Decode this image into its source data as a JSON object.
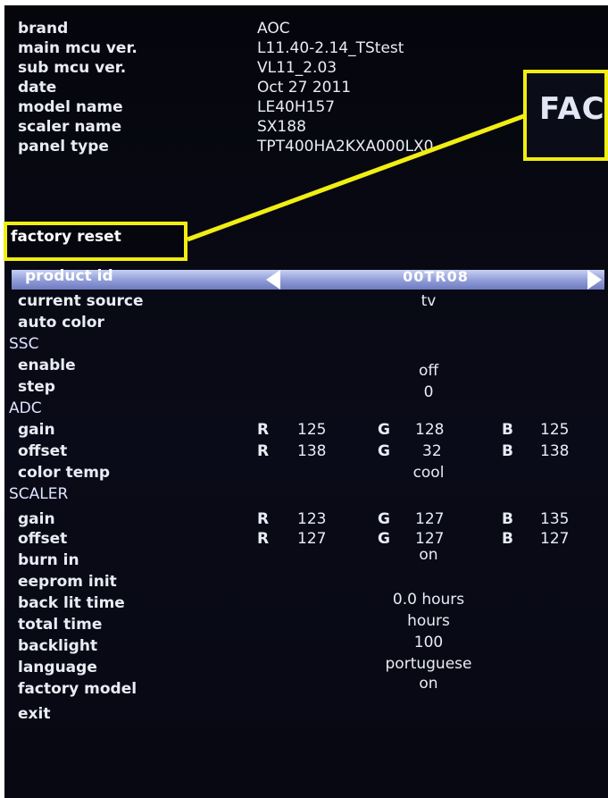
{
  "info": [
    {
      "label": "brand",
      "value": "AOC"
    },
    {
      "label": "main mcu ver.",
      "value": "L11.40-2.14_TStest"
    },
    {
      "label": "sub mcu ver.",
      "value": "VL11_2.03"
    },
    {
      "label": "date",
      "value": "Oct 27 2011"
    },
    {
      "label": "model name",
      "value": "LE40H157"
    },
    {
      "label": "scaler name",
      "value": "SX188"
    },
    {
      "label": "panel type",
      "value": "TPT400HA2KXA000LX0"
    }
  ],
  "callout": {
    "label": "factory reset",
    "zoom_text": "FAC"
  },
  "selected": {
    "label": "product id",
    "value": "00TR08"
  },
  "menu": {
    "current_source": {
      "label": "current source",
      "value": "tv"
    },
    "auto_color": {
      "label": "auto color"
    },
    "ssc": {
      "label": "SSC"
    },
    "enable": {
      "label": "enable",
      "value": "off"
    },
    "step": {
      "label": "step",
      "value": "0"
    },
    "adc": {
      "label": "ADC"
    },
    "adc_gain": {
      "label": "gain",
      "r_key": "R",
      "r": "125",
      "g_key": "G",
      "g": "128",
      "b_key": "B",
      "b": "125"
    },
    "adc_offset": {
      "label": "offset",
      "r_key": "R",
      "r": "138",
      "g_key": "G",
      "g": "32",
      "b_key": "B",
      "b": "138"
    },
    "color_temp": {
      "label": "color temp",
      "value": "cool"
    },
    "scaler": {
      "label": "SCALER"
    },
    "scaler_gain": {
      "label": "gain",
      "r_key": "R",
      "r": "123",
      "g_key": "G",
      "g": "127",
      "b_key": "B",
      "b": "135"
    },
    "scaler_offset": {
      "label": "offset",
      "r_key": "R",
      "r": "127",
      "g_key": "G",
      "g": "127",
      "b_key": "B",
      "b": "127"
    },
    "burn_in": {
      "label": "burn in",
      "value": "on"
    },
    "eeprom_init": {
      "label": "eeprom init"
    },
    "back_lit_time": {
      "label": "back lit time",
      "value": "0.0 hours"
    },
    "total_time": {
      "label": "total time",
      "value": "hours"
    },
    "backlight": {
      "label": "backlight",
      "value": "100"
    },
    "language": {
      "label": "language",
      "value": "portuguese"
    },
    "factory_model": {
      "label": "factory model",
      "value": "on"
    },
    "exit": {
      "label": "exit"
    }
  },
  "colors": {
    "highlight": "#f1ee12",
    "selection_bar": "#8f9bd6",
    "screen": "#05060c"
  }
}
